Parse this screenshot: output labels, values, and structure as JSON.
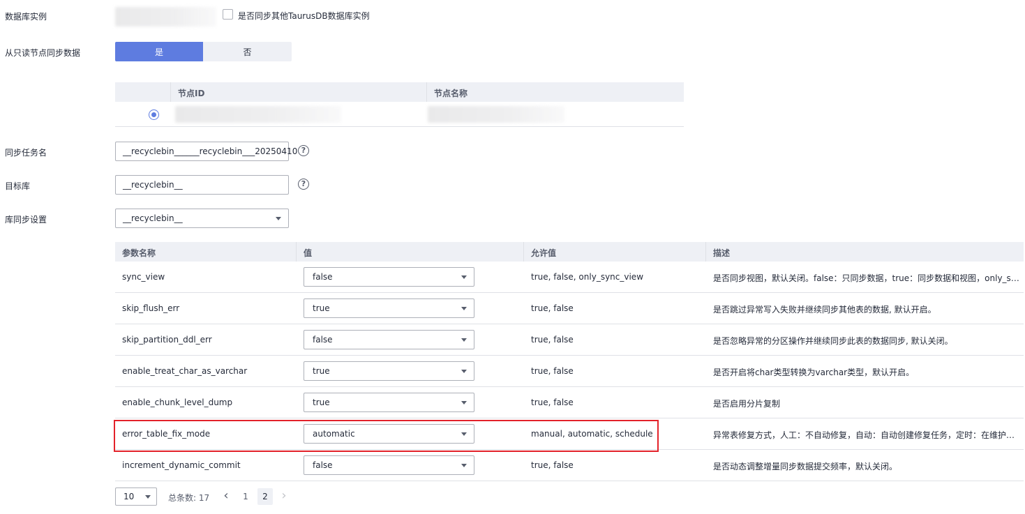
{
  "labels": {
    "db_instance": "数据库实例",
    "sync_from_readonly": "从只读节点同步数据",
    "task_name": "同步任务名",
    "target_db": "目标库",
    "db_sync_settings": "库同步设置"
  },
  "sync_other_checkbox": "是否同步其他TaurusDB数据库实例",
  "readonly_toggle": {
    "yes": "是",
    "no": "否",
    "selected": "是"
  },
  "node_table": {
    "headers": [
      "节点ID",
      "节点名称"
    ]
  },
  "task_name_value": "__recyclebin______recyclebin___20250410",
  "target_db_value": "__recyclebin__",
  "db_sync_select_value": "__recyclebin__",
  "help_glyph": "?",
  "param_table": {
    "headers": [
      "参数名称",
      "值",
      "允许值",
      "描述"
    ],
    "rows": [
      {
        "name": "sync_view",
        "value": "false",
        "allowed": "true, false, only_sync_view",
        "desc": "是否同步视图，默认关闭。false：只同步数据，true：同步数据和视图，only_sync_view：只同步视图"
      },
      {
        "name": "skip_flush_err",
        "value": "true",
        "allowed": "true, false",
        "desc": "是否跳过异常写入失败并继续同步其他表的数据, 默认开启。"
      },
      {
        "name": "skip_partition_ddl_err",
        "value": "false",
        "allowed": "true, false",
        "desc": "是否忽略异常的分区操作并继续同步此表的数据同步, 默认关闭。"
      },
      {
        "name": "enable_treat_char_as_varchar",
        "value": "true",
        "allowed": "true, false",
        "desc": "是否开启将char类型转换为varchar类型，默认开启。"
      },
      {
        "name": "enable_chunk_level_dump",
        "value": "true",
        "allowed": "true, false",
        "desc": "是否启用分片复制"
      },
      {
        "name": "error_table_fix_mode",
        "value": "automatic",
        "allowed": "manual, automatic, schedule",
        "desc": "异常表修复方式，人工：不自动修复，自动：自动创建修复任务，定时：在维护窗口内修复"
      },
      {
        "name": "increment_dynamic_commit",
        "value": "false",
        "allowed": "true, false",
        "desc": "是否动态调整增量同步数据提交频率，默认关闭。"
      }
    ]
  },
  "pagination": {
    "page_size": "10",
    "total": "总条数: 17",
    "prev": "‹",
    "pages": [
      "1",
      "2"
    ],
    "current": "2",
    "next": "›"
  },
  "colors": {
    "primary": "#5e7ce0",
    "highlight": "#e3222a"
  }
}
